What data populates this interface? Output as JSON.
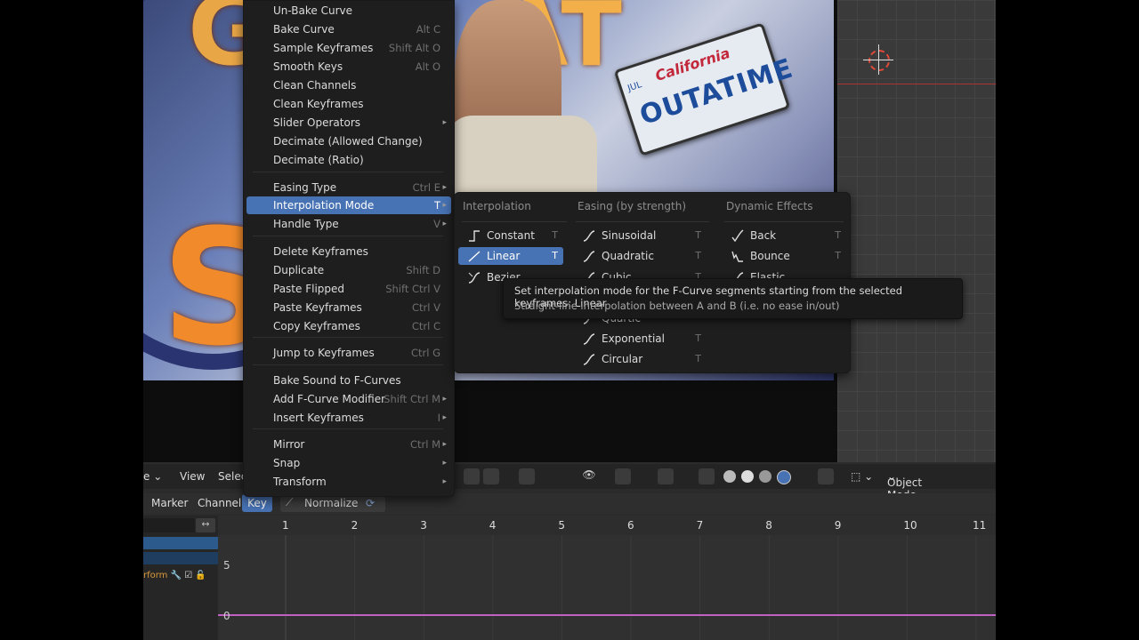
{
  "key_menu": {
    "items": [
      {
        "label": "Un-Bake Curve",
        "shortcut": "",
        "arrow": false
      },
      {
        "label": "Bake Curve",
        "shortcut": "Alt C",
        "arrow": false
      },
      {
        "label": "Sample Keyframes",
        "shortcut": "Shift Alt O",
        "arrow": false
      },
      {
        "label": "Smooth Keys",
        "shortcut": "Alt O",
        "arrow": false
      },
      {
        "label": "Clean Channels",
        "shortcut": "",
        "arrow": false
      },
      {
        "label": "Clean Keyframes",
        "shortcut": "",
        "arrow": false
      },
      {
        "label": "Slider Operators",
        "shortcut": "",
        "arrow": true
      },
      {
        "label": "Decimate (Allowed Change)",
        "shortcut": "",
        "arrow": false
      },
      {
        "label": "Decimate (Ratio)",
        "shortcut": "",
        "arrow": false
      },
      {
        "label": "Easing Type",
        "shortcut": "Ctrl E",
        "arrow": true
      },
      {
        "label": "Interpolation Mode",
        "shortcut": "T",
        "arrow": true
      },
      {
        "label": "Handle Type",
        "shortcut": "V",
        "arrow": true
      },
      {
        "label": "Delete Keyframes",
        "shortcut": "",
        "arrow": false
      },
      {
        "label": "Duplicate",
        "shortcut": "Shift D",
        "arrow": false
      },
      {
        "label": "Paste Flipped",
        "shortcut": "Shift Ctrl V",
        "arrow": false
      },
      {
        "label": "Paste Keyframes",
        "shortcut": "Ctrl V",
        "arrow": false
      },
      {
        "label": "Copy Keyframes",
        "shortcut": "Ctrl C",
        "arrow": false
      },
      {
        "label": "Jump to Keyframes",
        "shortcut": "Ctrl G",
        "arrow": false
      },
      {
        "label": "Bake Sound to F-Curves",
        "shortcut": "",
        "arrow": false
      },
      {
        "label": "Add F-Curve Modifier",
        "shortcut": "Shift Ctrl M",
        "arrow": true
      },
      {
        "label": "Insert Keyframes",
        "shortcut": "I",
        "arrow": true
      },
      {
        "label": "Mirror",
        "shortcut": "Ctrl M",
        "arrow": true
      },
      {
        "label": "Snap",
        "shortcut": "",
        "arrow": true
      },
      {
        "label": "Transform",
        "shortcut": "",
        "arrow": true
      }
    ]
  },
  "interpolation_submenu": {
    "headers": [
      "Interpolation",
      "Easing (by strength)",
      "Dynamic Effects"
    ],
    "interpolation": [
      {
        "label": "Constant",
        "shortcut": "T"
      },
      {
        "label": "Linear",
        "shortcut": "T",
        "selected": true
      },
      {
        "label": "Bezier",
        "shortcut": ""
      }
    ],
    "easing": [
      {
        "label": "Sinusoidal",
        "shortcut": "T"
      },
      {
        "label": "Quadratic",
        "shortcut": "T"
      },
      {
        "label": "Cubic",
        "shortcut": "T"
      },
      {
        "label": "Quartic",
        "shortcut": ""
      },
      {
        "label": "Exponential",
        "shortcut": "T"
      },
      {
        "label": "Circular",
        "shortcut": "T"
      }
    ],
    "dynamic": [
      {
        "label": "Back",
        "shortcut": "T"
      },
      {
        "label": "Bounce",
        "shortcut": "T"
      },
      {
        "label": "Elastic",
        "shortcut": ""
      }
    ]
  },
  "tooltip": {
    "line1": "Set interpolation mode for the F-Curve segments starting from the selected keyframes:  Linear",
    "line2": "Straight-line interpolation between A and B (i.e. no ease in/out)"
  },
  "viewport_header": {
    "view_label": "View",
    "select_label": "Selec",
    "mode_label": "Object Mode"
  },
  "graph_header": {
    "marker": "Marker",
    "channel": "Channel",
    "key": "Key",
    "normalize": "Normalize"
  },
  "ruler_frames": [
    "1",
    "2",
    "3",
    "4",
    "5",
    "6",
    "7",
    "8",
    "9",
    "10",
    "11"
  ],
  "value_axis": {
    "top": "5",
    "bottom": "0"
  },
  "channel_row_label": "rform",
  "plate": {
    "state": "California",
    "text": "OUTATIME",
    "month": "JUL"
  },
  "photo_letters": {
    "top": "G",
    "left": "S",
    "right": "AT"
  },
  "colors": {
    "accent": "#4772b3",
    "curve": "#c25fc2",
    "cursor": "#e04a3a"
  }
}
